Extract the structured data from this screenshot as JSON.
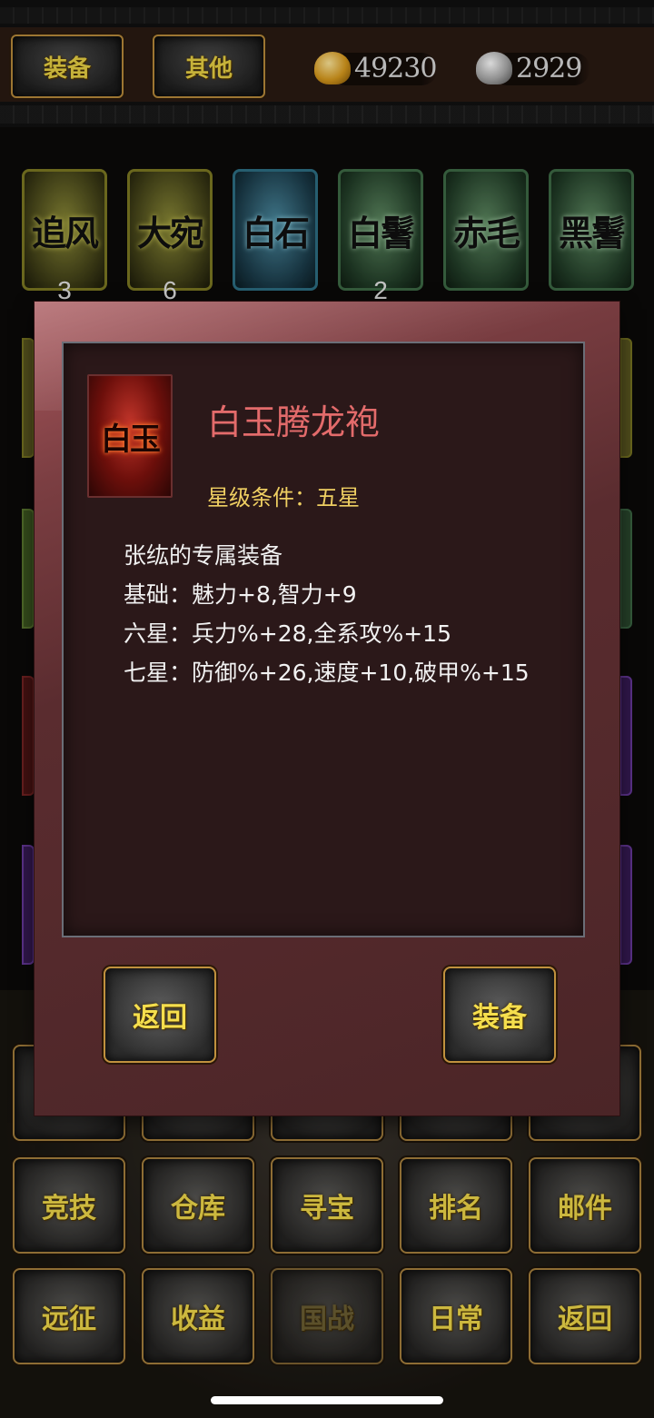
{
  "top_bar": {
    "tabs": [
      {
        "label": "装备"
      },
      {
        "label": "其他"
      }
    ],
    "gold": "49230",
    "silver": "2929"
  },
  "horses": [
    {
      "name": "追风",
      "count": "3",
      "color": "yellow"
    },
    {
      "name": "大宛",
      "count": "6",
      "color": "yellow"
    },
    {
      "name": "白石",
      "count": "",
      "color": "blue"
    },
    {
      "name": "白鬐",
      "count": "2",
      "color": "green"
    },
    {
      "name": "赤毛",
      "count": "",
      "color": "green"
    },
    {
      "name": "黑鬐",
      "count": "",
      "color": "green"
    }
  ],
  "modal": {
    "icon_text": "白玉",
    "item_name": "白玉腾龙袍",
    "star_requirement": "星级条件：五星",
    "description_lines": [
      "张纮的专属装备",
      "基础：魅力+8,智力+9",
      "六星：兵力%+28,全系攻%+15",
      "七星：防御%+26,速度+10,破甲%+15"
    ],
    "back_label": "返回",
    "equip_label": "装备"
  },
  "menu": {
    "row2": [
      "竞技",
      "仓库",
      "寻宝",
      "排名",
      "邮件"
    ],
    "row3": [
      "远征",
      "收益",
      "国战",
      "日常",
      "返回"
    ]
  },
  "colors": {
    "item_name": "#e36b6b",
    "star_requirement": "#efcf62",
    "button_text": "#f0d94a"
  }
}
